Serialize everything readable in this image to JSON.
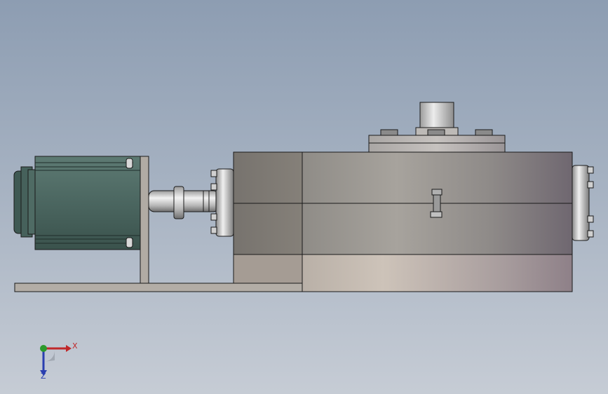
{
  "scene": {
    "view": "front",
    "components": {
      "motor": "servo-motor",
      "coupling": "shaft-coupling",
      "gearbox": "gearbox-housing",
      "output_flange": "top-output-flange",
      "base": "base-plate",
      "bracket": "motor-bracket"
    }
  },
  "triad": {
    "x_label": "X",
    "z_label": "Z",
    "colors": {
      "x": "#c0282a",
      "y": "#2c9a2c",
      "z": "#2a3fb0"
    }
  },
  "colors": {
    "background_top": "#8d9db2",
    "background_bottom": "#c6ccd5",
    "motor_green": "#4b6660",
    "housing_gray": "#8f8b86"
  }
}
